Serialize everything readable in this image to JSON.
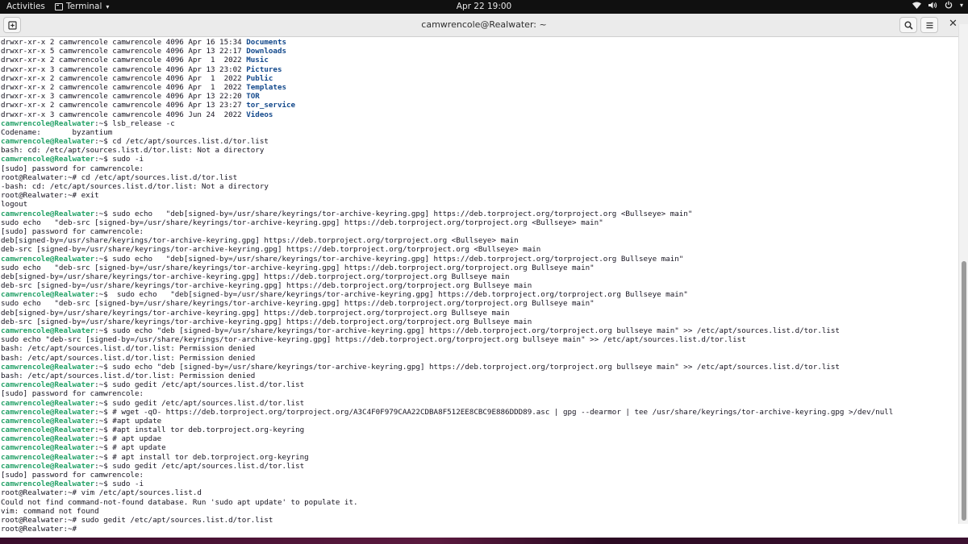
{
  "topbar": {
    "activities": "Activities",
    "app_name": "Terminal",
    "clock": "Apr 22  19:00"
  },
  "window": {
    "title": "camwrencole@Realwater: ~"
  },
  "colors": {
    "prompt": "#26a269",
    "directory": "#12488b",
    "text": "#171421",
    "topbar": "#101010",
    "headerbar": "#ebebeb"
  },
  "icons": {
    "new_tab": "new-tab-icon",
    "search": "search-icon",
    "menu": "hamburger-menu-icon",
    "close": "close-icon",
    "wifi": "wifi-icon",
    "volume": "volume-icon",
    "power": "power-icon"
  },
  "terminal_lines": [
    [
      {
        "t": "drwxr-xr-x 2 camwrencole camwrencole 4096 Apr 16 15:34 "
      },
      {
        "t": "Documents",
        "c": "d"
      }
    ],
    [
      {
        "t": "drwxr-xr-x 5 camwrencole camwrencole 4096 Apr 13 22:17 "
      },
      {
        "t": "Downloads",
        "c": "d"
      }
    ],
    [
      {
        "t": "drwxr-xr-x 2 camwrencole camwrencole 4096 Apr  1  2022 "
      },
      {
        "t": "Music",
        "c": "d"
      }
    ],
    [
      {
        "t": "drwxr-xr-x 3 camwrencole camwrencole 4096 Apr 13 23:02 "
      },
      {
        "t": "Pictures",
        "c": "d"
      }
    ],
    [
      {
        "t": "drwxr-xr-x 2 camwrencole camwrencole 4096 Apr  1  2022 "
      },
      {
        "t": "Public",
        "c": "d"
      }
    ],
    [
      {
        "t": "drwxr-xr-x 2 camwrencole camwrencole 4096 Apr  1  2022 "
      },
      {
        "t": "Templates",
        "c": "d"
      }
    ],
    [
      {
        "t": "drwxr-xr-x 3 camwrencole camwrencole 4096 Apr 13 22:20 "
      },
      {
        "t": "TOR",
        "c": "d"
      }
    ],
    [
      {
        "t": "drwxr-xr-x 2 camwrencole camwrencole 4096 Apr 13 23:27 "
      },
      {
        "t": "tor_service",
        "c": "d"
      }
    ],
    [
      {
        "t": "drwxr-xr-x 3 camwrencole camwrencole 4096 Jun 24  2022 "
      },
      {
        "t": "Videos",
        "c": "d"
      }
    ],
    [
      {
        "t": "camwrencole@Realwater",
        "c": "p"
      },
      {
        "t": ":~$ lsb_release -c"
      }
    ],
    [
      {
        "t": "Codename:\tbyzantium"
      }
    ],
    [
      {
        "t": "camwrencole@Realwater",
        "c": "p"
      },
      {
        "t": ":~$ cd /etc/apt/sources.list.d/tor.list"
      }
    ],
    [
      {
        "t": "bash: cd: /etc/apt/sources.list.d/tor.list: Not a directory"
      }
    ],
    [
      {
        "t": "camwrencole@Realwater",
        "c": "p"
      },
      {
        "t": ":~$ sudo -i"
      }
    ],
    [
      {
        "t": "[sudo] password for camwrencole:"
      }
    ],
    [
      {
        "t": "root@Realwater:~# cd /etc/apt/sources.list.d/tor.list"
      }
    ],
    [
      {
        "t": "-bash: cd: /etc/apt/sources.list.d/tor.list: Not a directory"
      }
    ],
    [
      {
        "t": "root@Realwater:~# exit"
      }
    ],
    [
      {
        "t": "logout"
      }
    ],
    [
      {
        "t": "camwrencole@Realwater",
        "c": "p"
      },
      {
        "t": ":~$ sudo echo   \"deb[signed-by=/usr/share/keyrings/tor-archive-keyring.gpg] https://deb.torproject.org/torproject.org <Bullseye> main\""
      }
    ],
    [
      {
        "t": "sudo echo   \"deb-src [signed-by=/usr/share/keyrings/tor-archive-keyring.gpg] https://deb.torproject.org/torproject.org <Bullseye> main\""
      }
    ],
    [
      {
        "t": "[sudo] password for camwrencole:"
      }
    ],
    [
      {
        "t": "deb[signed-by=/usr/share/keyrings/tor-archive-keyring.gpg] https://deb.torproject.org/torproject.org <Bullseye> main"
      }
    ],
    [
      {
        "t": "deb-src [signed-by=/usr/share/keyrings/tor-archive-keyring.gpg] https://deb.torproject.org/torproject.org <Bullseye> main"
      }
    ],
    [
      {
        "t": "camwrencole@Realwater",
        "c": "p"
      },
      {
        "t": ":~$ sudo echo   \"deb[signed-by=/usr/share/keyrings/tor-archive-keyring.gpg] https://deb.torproject.org/torproject.org Bullseye main\""
      }
    ],
    [
      {
        "t": "sudo echo   \"deb-src [signed-by=/usr/share/keyrings/tor-archive-keyring.gpg] https://deb.torproject.org/torproject.org Bullseye main\""
      }
    ],
    [
      {
        "t": "deb[signed-by=/usr/share/keyrings/tor-archive-keyring.gpg] https://deb.torproject.org/torproject.org Bullseye main"
      }
    ],
    [
      {
        "t": "deb-src [signed-by=/usr/share/keyrings/tor-archive-keyring.gpg] https://deb.torproject.org/torproject.org Bullseye main"
      }
    ],
    [
      {
        "t": "camwrencole@Realwater",
        "c": "p"
      },
      {
        "t": ":~$  sudo echo   \"deb[signed-by=/usr/share/keyrings/tor-archive-keyring.gpg] https://deb.torproject.org/torproject.org Bullseye main\""
      }
    ],
    [
      {
        "t": "sudo echo   \"deb-src [signed-by=/usr/share/keyrings/tor-archive-keyring.gpg] https://deb.torproject.org/torproject.org Bullseye main\""
      }
    ],
    [
      {
        "t": "deb[signed-by=/usr/share/keyrings/tor-archive-keyring.gpg] https://deb.torproject.org/torproject.org Bullseye main"
      }
    ],
    [
      {
        "t": "deb-src [signed-by=/usr/share/keyrings/tor-archive-keyring.gpg] https://deb.torproject.org/torproject.org Bullseye main"
      }
    ],
    [
      {
        "t": "camwrencole@Realwater",
        "c": "p"
      },
      {
        "t": ":~$ sudo echo \"deb [signed-by=/usr/share/keyrings/tor-archive-keyring.gpg] https://deb.torproject.org/torproject.org bullseye main\" >> /etc/apt/sources.list.d/tor.list"
      }
    ],
    [
      {
        "t": "sudo echo \"deb-src [signed-by=/usr/share/keyrings/tor-archive-keyring.gpg] https://deb.torproject.org/torproject.org bullseye main\" >> /etc/apt/sources.list.d/tor.list"
      }
    ],
    [
      {
        "t": "bash: /etc/apt/sources.list.d/tor.list: Permission denied"
      }
    ],
    [
      {
        "t": "bash: /etc/apt/sources.list.d/tor.list: Permission denied"
      }
    ],
    [
      {
        "t": "camwrencole@Realwater",
        "c": "p"
      },
      {
        "t": ":~$ sudo echo \"deb [signed-by=/usr/share/keyrings/tor-archive-keyring.gpg] https://deb.torproject.org/torproject.org bullseye main\" >> /etc/apt/sources.list.d/tor.list"
      }
    ],
    [
      {
        "t": "bash: /etc/apt/sources.list.d/tor.list: Permission denied"
      }
    ],
    [
      {
        "t": "camwrencole@Realwater",
        "c": "p"
      },
      {
        "t": ":~$ sudo gedit /etc/apt/sources.list.d/tor.list"
      }
    ],
    [
      {
        "t": "[sudo] password for camwrencole:"
      }
    ],
    [
      {
        "t": "camwrencole@Realwater",
        "c": "p"
      },
      {
        "t": ":~$ sudo gedit /etc/apt/sources.list.d/tor.list"
      }
    ],
    [
      {
        "t": "camwrencole@Realwater",
        "c": "p"
      },
      {
        "t": ":~$ # wget -qO- https://deb.torproject.org/torproject.org/A3C4F0F979CAA22CDBA8F512EE8CBC9E886DDD89.asc | gpg --dearmor | tee /usr/share/keyrings/tor-archive-keyring.gpg >/dev/null"
      }
    ],
    [
      {
        "t": "camwrencole@Realwater",
        "c": "p"
      },
      {
        "t": ":~$ #apt update"
      }
    ],
    [
      {
        "t": "camwrencole@Realwater",
        "c": "p"
      },
      {
        "t": ":~$ #apt install tor deb.torproject.org-keyring"
      }
    ],
    [
      {
        "t": "camwrencole@Realwater",
        "c": "p"
      },
      {
        "t": ":~$ # apt updae"
      }
    ],
    [
      {
        "t": "camwrencole@Realwater",
        "c": "p"
      },
      {
        "t": ":~$ # apt update"
      }
    ],
    [
      {
        "t": "camwrencole@Realwater",
        "c": "p"
      },
      {
        "t": ":~$ # apt install tor deb.torproject.org-keyring"
      }
    ],
    [
      {
        "t": "camwrencole@Realwater",
        "c": "p"
      },
      {
        "t": ":~$ sudo gedit /etc/apt/sources.list.d/tor.list"
      }
    ],
    [
      {
        "t": "[sudo] password for camwrencole:"
      }
    ],
    [
      {
        "t": "camwrencole@Realwater",
        "c": "p"
      },
      {
        "t": ":~$ sudo -i"
      }
    ],
    [
      {
        "t": "root@Realwater:~# vim /etc/apt/sources.list.d"
      }
    ],
    [
      {
        "t": "Could not find command-not-found database. Run 'sudo apt update' to populate it."
      }
    ],
    [
      {
        "t": "vim: command not found"
      }
    ],
    [
      {
        "t": "root@Realwater:~# sudo gedit /etc/apt/sources.list.d/tor.list"
      }
    ],
    [
      {
        "t": "root@Realwater:~# "
      }
    ]
  ]
}
